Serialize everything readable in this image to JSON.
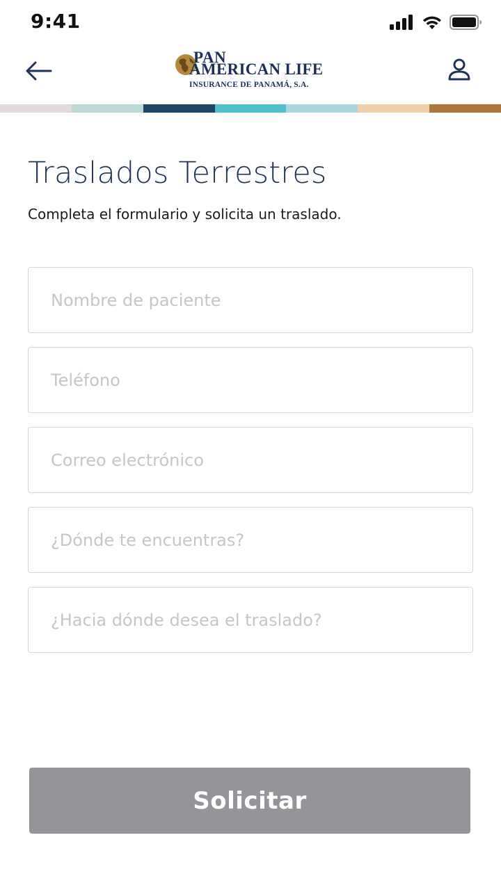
{
  "status_bar": {
    "time": "9:41",
    "icons": [
      "cellular-signal-icon",
      "wifi-icon",
      "battery-icon"
    ]
  },
  "header": {
    "back_icon": "arrow-left-icon",
    "logo": {
      "line1": "PAN",
      "line2": "AMERICAN LIFE",
      "line3": "INSURANCE DE PANAMÁ, S.A."
    },
    "profile_icon": "user-icon"
  },
  "stripe_colors": [
    "#e3d8db",
    "#bcd9d5",
    "#1d4667",
    "#4fc1cd",
    "#a9d7dc",
    "#f1cfaa",
    "#ad793b"
  ],
  "page": {
    "title": "Traslados Terrestres",
    "subtitle": "Completa el formulario y solicita un traslado."
  },
  "form": {
    "fields": [
      {
        "placeholder": "Nombre de paciente",
        "value": ""
      },
      {
        "placeholder": "Teléfono",
        "value": ""
      },
      {
        "placeholder": "Correo electrónico",
        "value": ""
      },
      {
        "placeholder": "¿Dónde te encuentras?",
        "value": ""
      },
      {
        "placeholder": "¿Hacia dónde desea el traslado?",
        "value": ""
      }
    ],
    "submit_label": "Solicitar"
  },
  "colors": {
    "brand_navy": "#1d3455",
    "button_disabled": "#939598",
    "field_border": "#d6d6d6",
    "placeholder": "#c6c6c6"
  }
}
